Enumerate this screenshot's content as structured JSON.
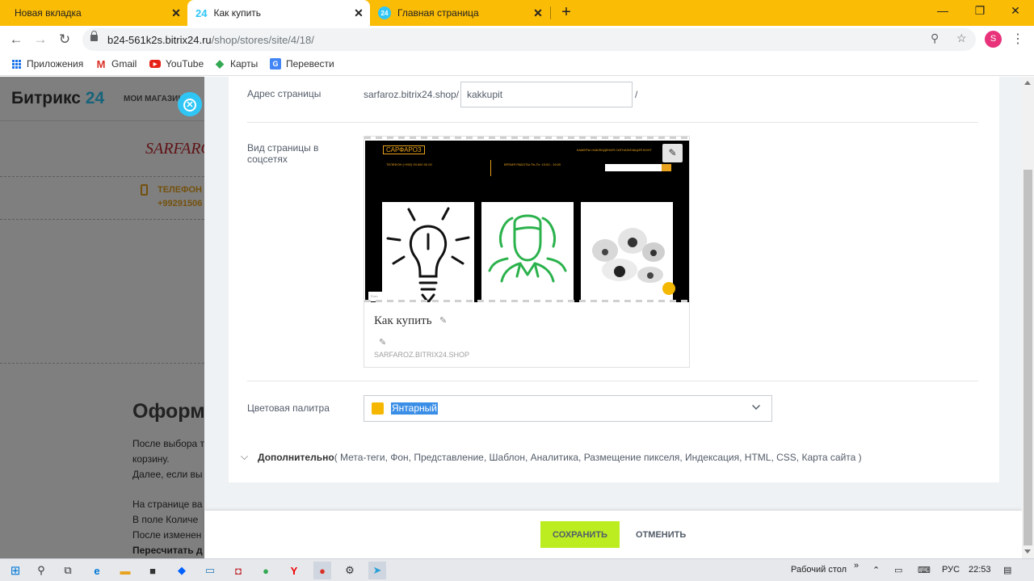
{
  "browser": {
    "tabs": [
      {
        "title": "Новая вкладка"
      },
      {
        "title": "Как купить",
        "favicon": "24"
      },
      {
        "title": "Главная страница",
        "favicon": "24"
      }
    ],
    "url_host": "b24-561k2s.bitrix24.ru",
    "url_path": "/shop/stores/site/4/18/",
    "avatar_letter": "S",
    "bookmarks": [
      "Приложения",
      "Gmail",
      "YouTube",
      "Карты",
      "Перевести"
    ]
  },
  "background": {
    "logo_main": "Битрикс",
    "logo_num": "24",
    "nav_label": "МОИ МАГАЗИН",
    "brand": "SARFARO",
    "phone_label": "ТЕЛЕФОН",
    "phone_number": "+99291506",
    "title": "Оформ",
    "paragraphs": [
      "После выбора т",
      "корзину.",
      "Далее, если вы",
      "На странице ва",
      "В поле Количе",
      "После изменен",
      "Пересчитать д"
    ]
  },
  "form": {
    "address": {
      "label": "Адрес страницы",
      "prefix": "sarfaroz.bitrix24.shop/",
      "value": "kakkupit",
      "suffix": "/"
    },
    "social": {
      "label": "Вид страницы в соцсетях",
      "shot_logo": "САРФАРОЗ",
      "shot_nav": "КАМЕРЫ НАБЛЮДЕНИЯ   СИГНАЛИЗАЦИЯ   КОНТ",
      "shot_info1": "ТЕЛЕФОН  (+992) 93 600 00 00",
      "shot_info2": "ВРЕМЯ РАБОТЫ  Пн-Пт: 10:00 - 19:00",
      "shot_tag": "Ёнги",
      "title": "Как купить",
      "domain": "SARFAROZ.BITRIX24.SHOP"
    },
    "palette": {
      "label": "Цветовая палитра",
      "value": "Янтарный",
      "swatch_color": "#f6b700"
    },
    "extra": {
      "label": "Дополнительно",
      "items": "( Мета-теги,  Фон,  Представление,  Шаблон,  Аналитика,  Размещение пикселя,  Индексация,  HTML,  CSS,  Карта сайта )"
    }
  },
  "actions": {
    "save": "СОХРАНИТЬ",
    "cancel": "ОТМЕНИТЬ"
  },
  "taskbar": {
    "desktop": "Рабочий стол",
    "lang": "РУС",
    "time": "22:53"
  }
}
